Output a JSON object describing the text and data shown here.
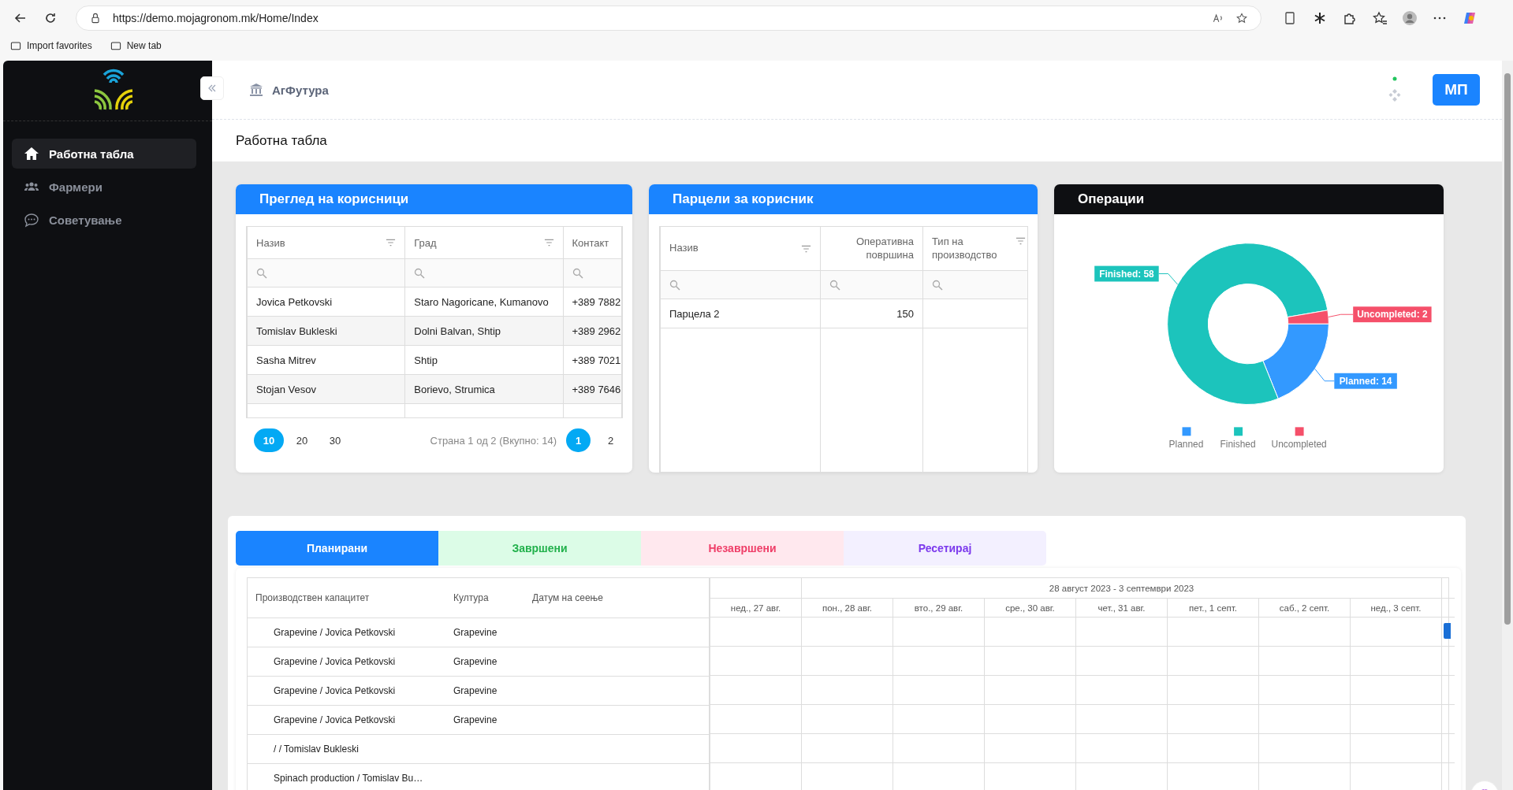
{
  "browser": {
    "url": "https://demo.mojagronom.mk/Home/Index",
    "bookmarks": [
      "Import favorites",
      "New tab"
    ]
  },
  "sidebar": {
    "items": [
      {
        "label": "Работна табла",
        "selected": true
      },
      {
        "label": "Фармери",
        "selected": false
      },
      {
        "label": "Советување",
        "selected": false
      }
    ]
  },
  "header": {
    "org": "АгФутура",
    "avatar": "МП"
  },
  "page_title": "Работна табла",
  "users_card": {
    "title": "Преглед на корисници",
    "columns": [
      "Назив",
      "Град",
      "Контакт"
    ],
    "rows": [
      {
        "name": "Jovica Petkovski",
        "city": "Staro Nagoricane, Kumanovo",
        "contact": "+389 7882"
      },
      {
        "name": "Tomislav Bukleski",
        "city": "Dolni Balvan, Shtip",
        "contact": "+389 2962"
      },
      {
        "name": "Sasha Mitrev",
        "city": "Shtip",
        "contact": "+389 7021"
      },
      {
        "name": "Stojan Vesov",
        "city": "Borievo, Strumica",
        "contact": "+389 7646"
      }
    ],
    "page_sizes": [
      {
        "label": "10",
        "selected": true
      },
      {
        "label": "20",
        "selected": false
      },
      {
        "label": "30",
        "selected": false
      }
    ],
    "page_info": "Страна 1 од 2 (Вкупно: 14)",
    "pages": [
      {
        "label": "1",
        "selected": true
      },
      {
        "label": "2",
        "selected": false
      }
    ]
  },
  "parcels_card": {
    "title": "Парцели за корисник",
    "columns": [
      "Назив",
      "Оперативна површина",
      "Тип на производство"
    ],
    "rows": [
      {
        "name": "Парцела 2",
        "area": "150"
      }
    ]
  },
  "operations_card": {
    "title": "Операции",
    "chart_data": {
      "type": "donut",
      "categories": [
        "Planned",
        "Finished",
        "Uncompleted"
      ],
      "values": [
        14,
        58,
        2
      ],
      "colors": [
        "#3399ff",
        "#1cc4bc",
        "#f5506a"
      ],
      "data_labels": true,
      "legend": "bottom",
      "value_labels": [
        "Planned: 14",
        "Finished: 58",
        "Uncompleted: 2"
      ]
    }
  },
  "schedule": {
    "tabs": [
      {
        "label": "Планирани",
        "kind": "planned",
        "selected": true
      },
      {
        "label": "Завршени",
        "kind": "finished",
        "selected": false
      },
      {
        "label": "Незавршени",
        "kind": "unfinished",
        "selected": false
      },
      {
        "label": "Ресетирај",
        "kind": "reset",
        "selected": false
      }
    ],
    "columns": [
      "Производствен капацитет",
      "Култура",
      "Датум на сеење"
    ],
    "range": "28 август 2023 - 3 септември 2023",
    "days": [
      "нед., 27 авг.",
      "пон., 28 авг.",
      "вто., 29 авг.",
      "сре., 30 авг.",
      "чет., 31 авг.",
      "пет., 1 септ.",
      "саб., 2 септ.",
      "нед., 3 септ."
    ],
    "rows": [
      {
        "name": "Grapevine / Jovica Petkovski",
        "culture": "Grapevine",
        "task_bar": true
      },
      {
        "name": "Grapevine / Jovica Petkovski",
        "culture": "Grapevine",
        "task_bar": false
      },
      {
        "name": "Grapevine / Jovica Petkovski",
        "culture": "Grapevine",
        "task_bar": false
      },
      {
        "name": "Grapevine / Jovica Petkovski",
        "culture": "Grapevine",
        "task_bar": false
      },
      {
        "name": "/ / Tomislav Bukleski",
        "task_bar": false
      },
      {
        "name": "Spinach production / Tomislav Bu…",
        "task_bar": false
      }
    ]
  }
}
